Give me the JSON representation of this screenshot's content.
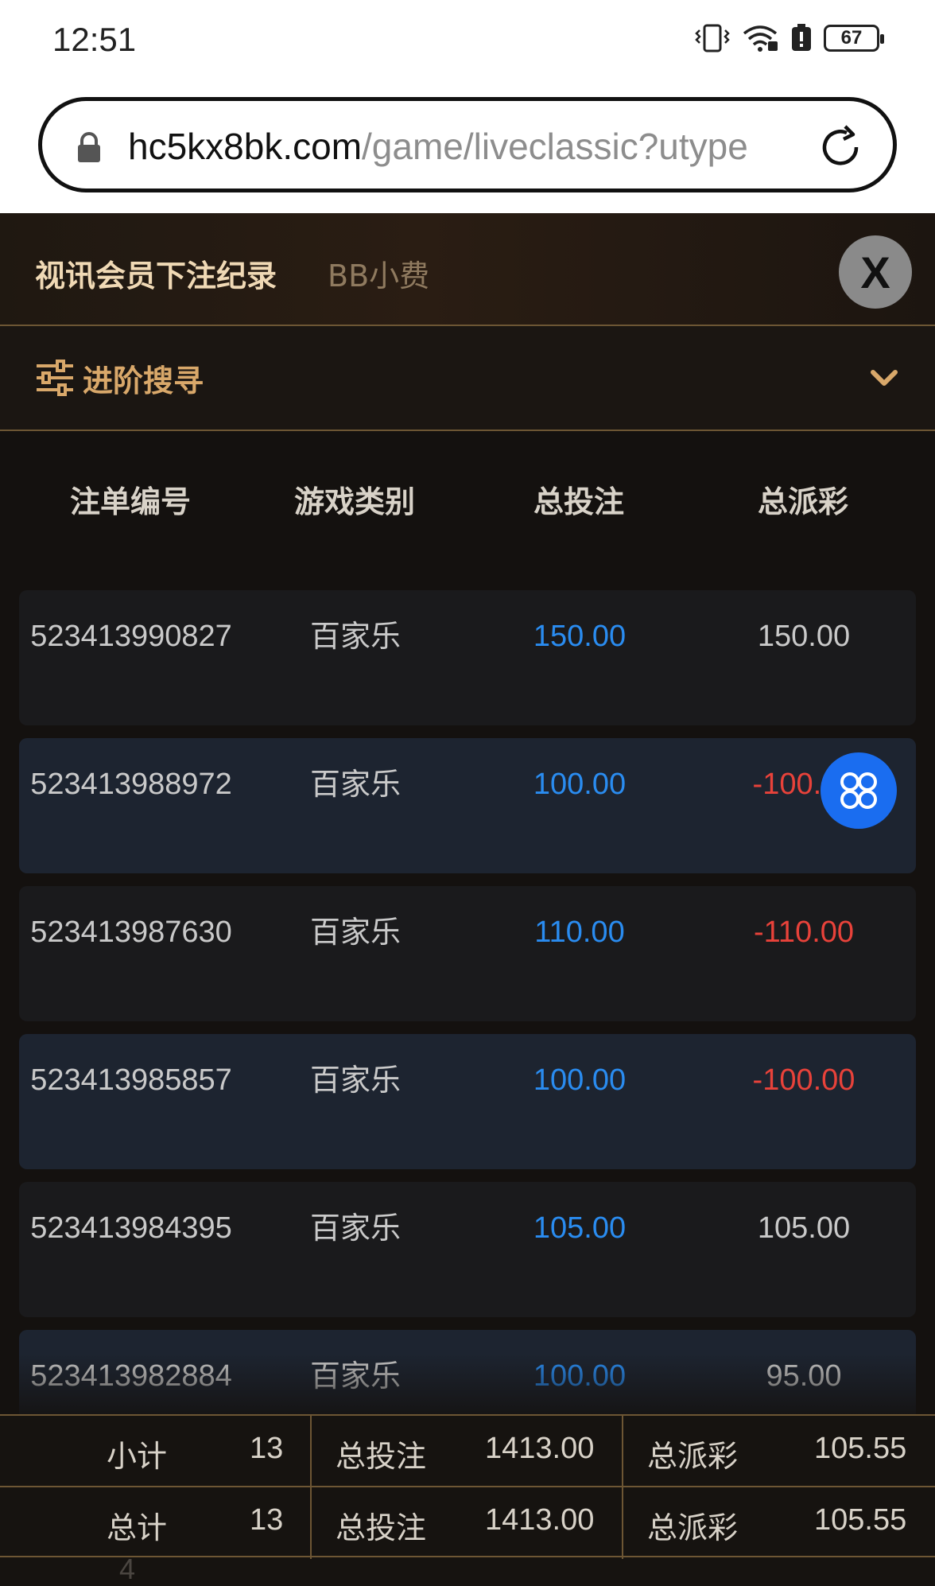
{
  "status_bar": {
    "time": "12:51",
    "battery": "67",
    "icons": [
      "vibrate-icon",
      "wifi-icon",
      "battery-saver-icon",
      "battery-icon"
    ]
  },
  "browser": {
    "url_host": "hc5kx8bk.com",
    "url_path": "/game/liveclassic?utype",
    "icons": [
      "lock-icon",
      "reload-icon"
    ]
  },
  "header": {
    "tab_active": "视讯会员下注纪录",
    "tab_inactive": "BB小费",
    "close_label": "X"
  },
  "advanced_search": {
    "label": "进阶搜寻",
    "icons": [
      "filter-icon",
      "chevron-down-icon"
    ]
  },
  "table": {
    "columns": [
      "注单编号",
      "游戏类别",
      "总投注",
      "总派彩"
    ],
    "rows": [
      {
        "id": "523413990827",
        "game": "百家乐",
        "bet": "150.00",
        "payout": "150.00",
        "negative": false
      },
      {
        "id": "523413988972",
        "game": "百家乐",
        "bet": "100.00",
        "payout": "-100.00",
        "negative": true
      },
      {
        "id": "523413987630",
        "game": "百家乐",
        "bet": "110.00",
        "payout": "-110.00",
        "negative": true
      },
      {
        "id": "523413985857",
        "game": "百家乐",
        "bet": "100.00",
        "payout": "-100.00",
        "negative": true
      },
      {
        "id": "523413984395",
        "game": "百家乐",
        "bet": "105.00",
        "payout": "105.00",
        "negative": false
      },
      {
        "id": "523413982884",
        "game": "百家乐",
        "bet": "100.00",
        "payout": "95.00",
        "negative": false
      }
    ]
  },
  "summary": {
    "subtotal": {
      "label": "小计",
      "count": "13",
      "bet_label": "总投注",
      "bet": "1413.00",
      "payout_label": "总派彩",
      "payout": "105.55"
    },
    "total": {
      "label": "总计",
      "count": "13",
      "bet_label": "总投注",
      "bet": "1413.00",
      "payout_label": "总派彩",
      "payout": "105.55"
    },
    "below_fragment": "4"
  },
  "colors": {
    "accent_gold": "#d9a86a",
    "bet_blue": "#2a8cf0",
    "negative_red": "#e8423a",
    "float_button": "#1a6df0"
  }
}
